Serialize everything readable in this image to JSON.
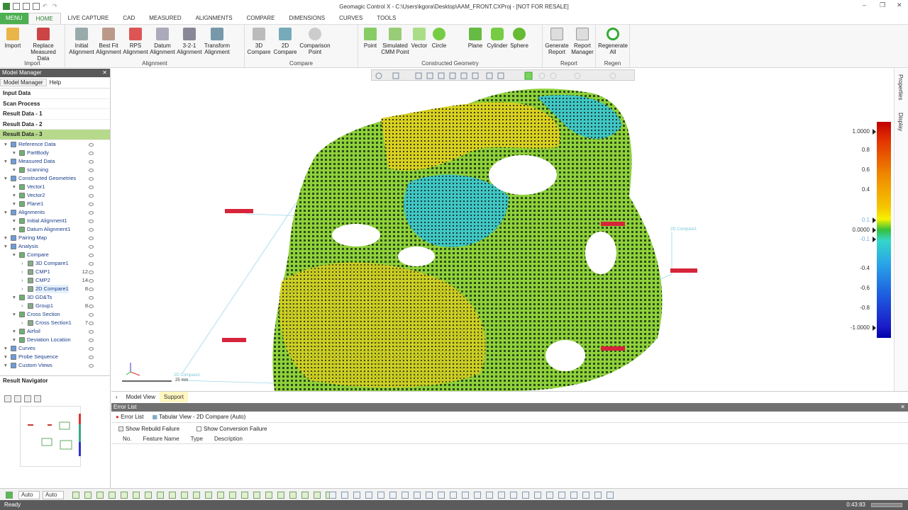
{
  "window": {
    "title": "Geomagic Control X - C:\\Users\\kgora\\Desktop\\AAM_FRONT.CXProj - [NOT FOR RESALE]"
  },
  "tabs": [
    "MENU",
    "HOME",
    "LIVE CAPTURE",
    "CAD",
    "MEASURED",
    "ALIGNMENTS",
    "COMPARE",
    "DIMENSIONS",
    "CURVES",
    "TOOLS"
  ],
  "ribbon": {
    "groups": [
      "Import",
      "Alignment",
      "Compare",
      "Constructed Geometry",
      "Report",
      "Regen"
    ],
    "buttons": [
      {
        "l1": "Import",
        "l2": ""
      },
      {
        "l1": "Replace",
        "l2": "Measured Data"
      },
      {
        "l1": "Initial",
        "l2": "Alignment"
      },
      {
        "l1": "Best Fit",
        "l2": "Alignment"
      },
      {
        "l1": "RPS",
        "l2": "Alignment"
      },
      {
        "l1": "Datum",
        "l2": "Alignment"
      },
      {
        "l1": "3-2-1",
        "l2": "Alignment"
      },
      {
        "l1": "Transform",
        "l2": "Alignment"
      },
      {
        "l1": "3D",
        "l2": "Compare"
      },
      {
        "l1": "2D",
        "l2": "Compare"
      },
      {
        "l1": "Comparison",
        "l2": "Point"
      },
      {
        "l1": "Point",
        "l2": ""
      },
      {
        "l1": "Simulated",
        "l2": "CMM Point"
      },
      {
        "l1": "Vector",
        "l2": ""
      },
      {
        "l1": "Circle",
        "l2": ""
      },
      {
        "l1": "Plane",
        "l2": ""
      },
      {
        "l1": "Cylinder",
        "l2": ""
      },
      {
        "l1": "Sphere",
        "l2": ""
      },
      {
        "l1": "Generate",
        "l2": "Report"
      },
      {
        "l1": "Report",
        "l2": "Manager"
      },
      {
        "l1": "Regenerate",
        "l2": "All"
      }
    ]
  },
  "model_manager": {
    "title": "Model Manager",
    "tabs": [
      "Model Manager",
      "Help"
    ],
    "sections": [
      "Input Data",
      "Scan Process",
      "Result Data - 1",
      "Result Data - 2",
      "Result Data - 3"
    ],
    "tree": [
      {
        "label": "Reference Data",
        "level": 0,
        "count": ""
      },
      {
        "label": "PartBody",
        "level": 1,
        "count": ""
      },
      {
        "label": "Measured Data",
        "level": 0,
        "count": ""
      },
      {
        "label": "scanning",
        "level": 1,
        "count": ""
      },
      {
        "label": "Constructed Geometries",
        "level": 0,
        "count": ""
      },
      {
        "label": "Vector1",
        "level": 1,
        "count": ""
      },
      {
        "label": "Vector2",
        "level": 1,
        "count": ""
      },
      {
        "label": "Plane1",
        "level": 1,
        "count": ""
      },
      {
        "label": "Alignments",
        "level": 0,
        "count": ""
      },
      {
        "label": "Initial Alignment1",
        "level": 1,
        "count": ""
      },
      {
        "label": "Datum Alignment1",
        "level": 1,
        "count": ""
      },
      {
        "label": "Pairing Map",
        "level": 0,
        "count": ""
      },
      {
        "label": "Analysis",
        "level": 0,
        "count": ""
      },
      {
        "label": "Compare",
        "level": 1,
        "count": ""
      },
      {
        "label": "3D Compare1",
        "level": 2,
        "count": ""
      },
      {
        "label": "CMP1",
        "level": 2,
        "count": "12"
      },
      {
        "label": "CMP2",
        "level": 2,
        "count": "14"
      },
      {
        "label": "2D Compare1",
        "level": 2,
        "count": "8"
      },
      {
        "label": "3D GD&Ts",
        "level": 1,
        "count": ""
      },
      {
        "label": "Group1",
        "level": 2,
        "count": "8"
      },
      {
        "label": "Cross Section",
        "level": 1,
        "count": ""
      },
      {
        "label": "Cross Section1",
        "level": 2,
        "count": "7"
      },
      {
        "label": "Airfoil",
        "level": 1,
        "count": ""
      },
      {
        "label": "Deviation Location",
        "level": 1,
        "count": ""
      },
      {
        "label": "Curves",
        "level": 0,
        "count": ""
      },
      {
        "label": "Probe Sequence",
        "level": 0,
        "count": ""
      },
      {
        "label": "Custom Views",
        "level": 0,
        "count": ""
      }
    ]
  },
  "result_navigator": "Result Navigator",
  "viewport": {
    "scale_label": "25 mm",
    "callouts": [
      "2D Compare1",
      "2D Compare1"
    ],
    "colorbar": {
      "max": "1.0000",
      "ticks": [
        "0.8",
        "0.6",
        "0.4",
        "0.1",
        "0.0000",
        "-0.1",
        "-0.4",
        "-0.6",
        "-0.8"
      ],
      "min": "-1.0000"
    },
    "side_tabs": [
      "Properties",
      "Display"
    ],
    "view_tabs": [
      "Model View",
      "Support"
    ]
  },
  "error_list": {
    "title": "Error List",
    "tabs": [
      "Error List",
      "Tabular View - 2D Compare (Auto)"
    ],
    "checks": [
      "Show Rebuild Failure",
      "Show Conversion Failure"
    ],
    "columns": [
      "No.",
      "Feature Name",
      "Type",
      "Description"
    ]
  },
  "bottom": {
    "dd1": "Auto",
    "dd2": "Auto"
  },
  "status": {
    "text": "Ready",
    "time": "0:43:83"
  },
  "colors": {
    "accent": "#4caf50",
    "selected": "#b7d98c"
  }
}
